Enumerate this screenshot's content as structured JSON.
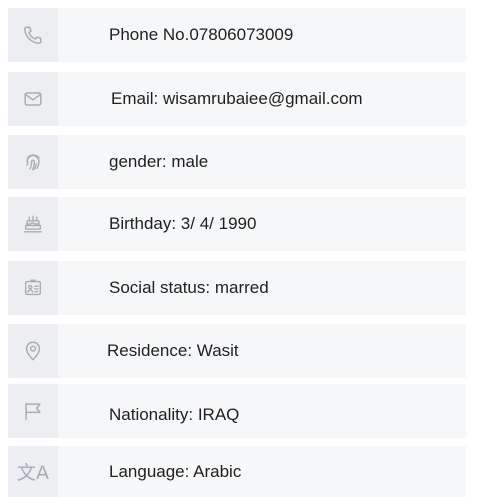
{
  "items": [
    {
      "icon": "phone-icon",
      "label": "Phone No.07806073009"
    },
    {
      "icon": "mail-icon",
      "label": "Email: wisamrubaiee@gmail.com"
    },
    {
      "icon": "fingerprint-icon",
      "label": "gender: male"
    },
    {
      "icon": "cake-icon",
      "label": "Birthday: 3/ 4/ 1990"
    },
    {
      "icon": "id-card-icon",
      "label": "Social status: marred"
    },
    {
      "icon": "location-pin-icon",
      "label": "Residence: Wasit"
    },
    {
      "icon": "flag-icon",
      "label": "Nationality: IRAQ"
    },
    {
      "icon": "translate-icon",
      "label": "Language: Arabic"
    }
  ],
  "colors": {
    "row_bg": "#f6f7f9",
    "icon_bg": "#eceef1",
    "icon": "#a8adb4",
    "text": "#1f1f1f"
  }
}
